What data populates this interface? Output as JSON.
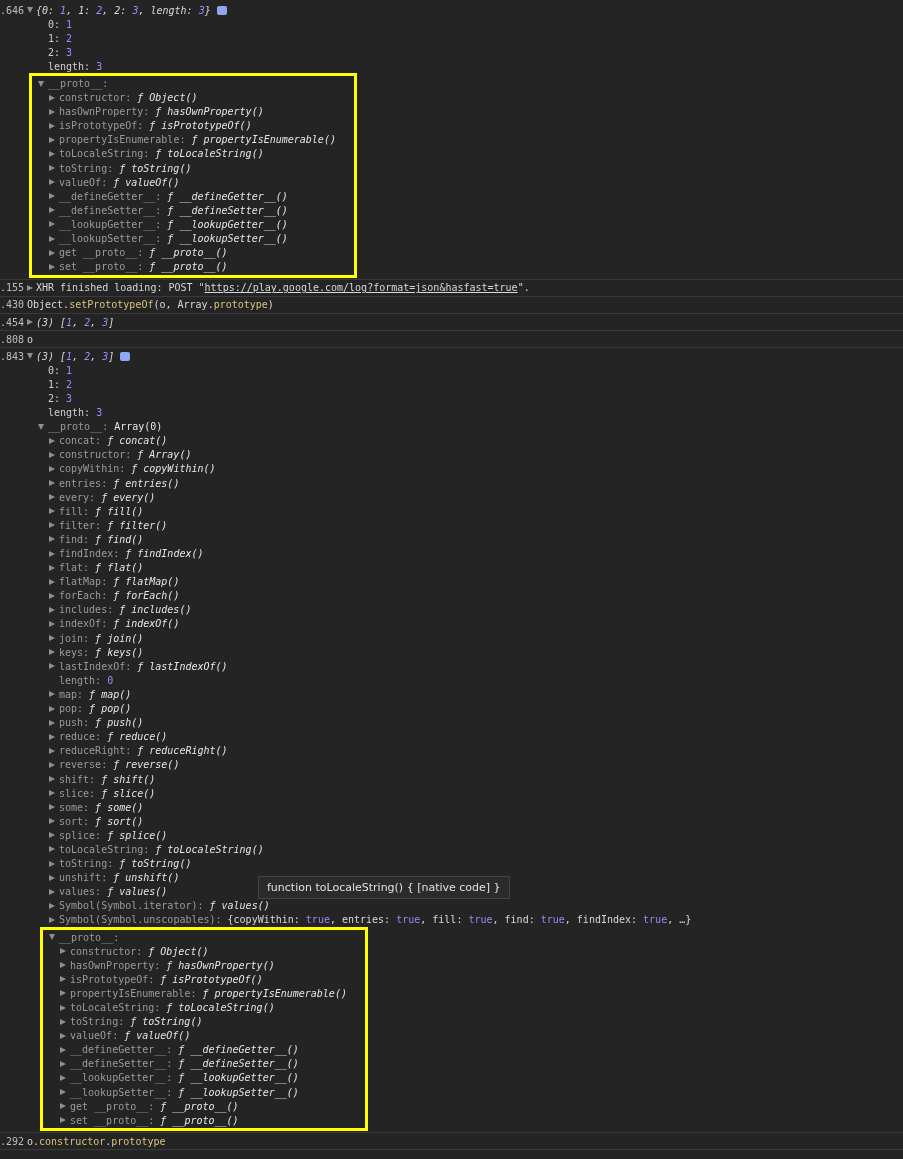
{
  "entries": [
    {
      "time": ".646",
      "kind": "value",
      "expanded": true,
      "info_badge": true,
      "tokens": [
        {
          "text": "{0: ",
          "kind": "punct"
        },
        {
          "text": "1",
          "kind": "number"
        },
        {
          "text": ", 1: ",
          "kind": "punct"
        },
        {
          "text": "2",
          "kind": "number"
        },
        {
          "text": ", 2: ",
          "kind": "punct"
        },
        {
          "text": "3",
          "kind": "number"
        },
        {
          "text": ", length: ",
          "kind": "punct"
        },
        {
          "text": "3",
          "kind": "number"
        },
        {
          "text": "}",
          "kind": "punct"
        }
      ],
      "children": [
        {
          "key": "0:",
          "value": "1",
          "kind": "number",
          "enumerable": true
        },
        {
          "key": "1:",
          "value": "2",
          "kind": "number",
          "enumerable": true
        },
        {
          "key": "2:",
          "value": "3",
          "kind": "number",
          "enumerable": true
        },
        {
          "key": "length:",
          "value": "3",
          "kind": "number",
          "enumerable": true
        },
        {
          "key": "__proto__:",
          "kind": "none",
          "enumerable": false,
          "expanded": true,
          "highlighted": true,
          "children": [
            {
              "key": "constructor:",
              "value": "ƒ Object()",
              "kind": "function",
              "enumerable": false,
              "expanded": false
            },
            {
              "key": "hasOwnProperty:",
              "value": "ƒ hasOwnProperty()",
              "kind": "function",
              "enumerable": false,
              "expanded": false
            },
            {
              "key": "isPrototypeOf:",
              "value": "ƒ isPrototypeOf()",
              "kind": "function",
              "enumerable": false,
              "expanded": false
            },
            {
              "key": "propertyIsEnumerable:",
              "value": "ƒ propertyIsEnumerable()",
              "kind": "function",
              "enumerable": false,
              "expanded": false
            },
            {
              "key": "toLocaleString:",
              "value": "ƒ toLocaleString()",
              "kind": "function",
              "enumerable": false,
              "expanded": false
            },
            {
              "key": "toString:",
              "value": "ƒ toString()",
              "kind": "function",
              "enumerable": false,
              "expanded": false
            },
            {
              "key": "valueOf:",
              "value": "ƒ valueOf()",
              "kind": "function",
              "enumerable": false,
              "expanded": false
            },
            {
              "key": "__defineGetter__:",
              "value": "ƒ __defineGetter__()",
              "kind": "function",
              "enumerable": false,
              "expanded": false
            },
            {
              "key": "__defineSetter__:",
              "value": "ƒ __defineSetter__()",
              "kind": "function",
              "enumerable": false,
              "expanded": false
            },
            {
              "key": "__lookupGetter__:",
              "value": "ƒ __lookupGetter__()",
              "kind": "function",
              "enumerable": false,
              "expanded": false
            },
            {
              "key": "__lookupSetter__:",
              "value": "ƒ __lookupSetter__()",
              "kind": "function",
              "enumerable": false,
              "expanded": false
            },
            {
              "key": "get __proto__:",
              "value": "ƒ __proto__()",
              "kind": "function",
              "enumerable": false,
              "expanded": false
            },
            {
              "key": "set __proto__:",
              "value": "ƒ __proto__()",
              "kind": "function",
              "enumerable": false,
              "expanded": false
            }
          ]
        }
      ]
    },
    {
      "time": ".155",
      "kind": "message",
      "expanded": false,
      "tokens": [
        {
          "text": "XHR finished loading: POST \"",
          "kind": "text"
        },
        {
          "text": "https://play.google.com/log?format=json&hasfast=true",
          "kind": "link"
        },
        {
          "text": "\".",
          "kind": "text"
        }
      ]
    },
    {
      "time": ".430",
      "kind": "command",
      "tokens": [
        {
          "text": "Object.",
          "kind": "text"
        },
        {
          "text": "setPrototypeOf",
          "kind": "member"
        },
        {
          "text": "(o, Array.",
          "kind": "text"
        },
        {
          "text": "prototype",
          "kind": "member"
        },
        {
          "text": ")",
          "kind": "text"
        }
      ]
    },
    {
      "time": ".454",
      "kind": "value",
      "expanded": false,
      "tokens": [
        {
          "text": "(3) [",
          "kind": "punct"
        },
        {
          "text": "1",
          "kind": "number"
        },
        {
          "text": ", ",
          "kind": "punct"
        },
        {
          "text": "2",
          "kind": "number"
        },
        {
          "text": ", ",
          "kind": "punct"
        },
        {
          "text": "3",
          "kind": "number"
        },
        {
          "text": "]",
          "kind": "punct"
        }
      ]
    },
    {
      "time": ".808",
      "kind": "command",
      "tokens": [
        {
          "text": "o",
          "kind": "text"
        }
      ]
    },
    {
      "time": ".843",
      "kind": "value",
      "expanded": true,
      "info_badge": true,
      "tokens": [
        {
          "text": "(3) [",
          "kind": "punct"
        },
        {
          "text": "1",
          "kind": "number"
        },
        {
          "text": ", ",
          "kind": "punct"
        },
        {
          "text": "2",
          "kind": "number"
        },
        {
          "text": ", ",
          "kind": "punct"
        },
        {
          "text": "3",
          "kind": "number"
        },
        {
          "text": "]",
          "kind": "punct"
        }
      ],
      "children": [
        {
          "key": "0:",
          "value": "1",
          "kind": "number",
          "enumerable": true
        },
        {
          "key": "1:",
          "value": "2",
          "kind": "number",
          "enumerable": true
        },
        {
          "key": "2:",
          "value": "3",
          "kind": "number",
          "enumerable": true
        },
        {
          "key": "length:",
          "value": "3",
          "kind": "number",
          "enumerable": true
        },
        {
          "key": "__proto__:",
          "value": "Array(0)",
          "kind": "plain",
          "enumerable": false,
          "expanded": true,
          "children": [
            {
              "key": "concat:",
              "value": "ƒ concat()",
              "kind": "function",
              "enumerable": false,
              "expanded": false
            },
            {
              "key": "constructor:",
              "value": "ƒ Array()",
              "kind": "function",
              "enumerable": false,
              "expanded": false
            },
            {
              "key": "copyWithin:",
              "value": "ƒ copyWithin()",
              "kind": "function",
              "enumerable": false,
              "expanded": false
            },
            {
              "key": "entries:",
              "value": "ƒ entries()",
              "kind": "function",
              "enumerable": false,
              "expanded": false
            },
            {
              "key": "every:",
              "value": "ƒ every()",
              "kind": "function",
              "enumerable": false,
              "expanded": false
            },
            {
              "key": "fill:",
              "value": "ƒ fill()",
              "kind": "function",
              "enumerable": false,
              "expanded": false
            },
            {
              "key": "filter:",
              "value": "ƒ filter()",
              "kind": "function",
              "enumerable": false,
              "expanded": false
            },
            {
              "key": "find:",
              "value": "ƒ find()",
              "kind": "function",
              "enumerable": false,
              "expanded": false
            },
            {
              "key": "findIndex:",
              "value": "ƒ findIndex()",
              "kind": "function",
              "enumerable": false,
              "expanded": false
            },
            {
              "key": "flat:",
              "value": "ƒ flat()",
              "kind": "function",
              "enumerable": false,
              "expanded": false
            },
            {
              "key": "flatMap:",
              "value": "ƒ flatMap()",
              "kind": "function",
              "enumerable": false,
              "expanded": false
            },
            {
              "key": "forEach:",
              "value": "ƒ forEach()",
              "kind": "function",
              "enumerable": false,
              "expanded": false
            },
            {
              "key": "includes:",
              "value": "ƒ includes()",
              "kind": "function",
              "enumerable": false,
              "expanded": false
            },
            {
              "key": "indexOf:",
              "value": "ƒ indexOf()",
              "kind": "function",
              "enumerable": false,
              "expanded": false
            },
            {
              "key": "join:",
              "value": "ƒ join()",
              "kind": "function",
              "enumerable": false,
              "expanded": false
            },
            {
              "key": "keys:",
              "value": "ƒ keys()",
              "kind": "function",
              "enumerable": false,
              "expanded": false
            },
            {
              "key": "lastIndexOf:",
              "value": "ƒ lastIndexOf()",
              "kind": "function",
              "enumerable": false,
              "expanded": false
            },
            {
              "key": "length:",
              "value": "0",
              "kind": "number",
              "enumerable": false
            },
            {
              "key": "map:",
              "value": "ƒ map()",
              "kind": "function",
              "enumerable": false,
              "expanded": false
            },
            {
              "key": "pop:",
              "value": "ƒ pop()",
              "kind": "function",
              "enumerable": false,
              "expanded": false
            },
            {
              "key": "push:",
              "value": "ƒ push()",
              "kind": "function",
              "enumerable": false,
              "expanded": false
            },
            {
              "key": "reduce:",
              "value": "ƒ reduce()",
              "kind": "function",
              "enumerable": false,
              "expanded": false
            },
            {
              "key": "reduceRight:",
              "value": "ƒ reduceRight()",
              "kind": "function",
              "enumerable": false,
              "expanded": false
            },
            {
              "key": "reverse:",
              "value": "ƒ reverse()",
              "kind": "function",
              "enumerable": false,
              "expanded": false
            },
            {
              "key": "shift:",
              "value": "ƒ shift()",
              "kind": "function",
              "enumerable": false,
              "expanded": false
            },
            {
              "key": "slice:",
              "value": "ƒ slice()",
              "kind": "function",
              "enumerable": false,
              "expanded": false
            },
            {
              "key": "some:",
              "value": "ƒ some()",
              "kind": "function",
              "enumerable": false,
              "expanded": false
            },
            {
              "key": "sort:",
              "value": "ƒ sort()",
              "kind": "function",
              "enumerable": false,
              "expanded": false
            },
            {
              "key": "splice:",
              "value": "ƒ splice()",
              "kind": "function",
              "enumerable": false,
              "expanded": false
            },
            {
              "key": "toLocaleString:",
              "value": "ƒ toLocaleString()",
              "kind": "function",
              "enumerable": false,
              "expanded": false
            },
            {
              "key": "toString:",
              "value": "ƒ toString()",
              "kind": "function",
              "enumerable": false,
              "expanded": false
            },
            {
              "key": "unshift:",
              "value": "ƒ unshift()",
              "kind": "function",
              "enumerable": false,
              "expanded": false
            },
            {
              "key": "values:",
              "value": "ƒ values()",
              "kind": "function",
              "enumerable": false,
              "expanded": false
            },
            {
              "key": "Symbol(Symbol.iterator):",
              "value": "ƒ values()",
              "kind": "function",
              "enumerable": false,
              "expanded": false
            },
            {
              "key": "Symbol(Symbol.unscopables):",
              "kind": "preview",
              "value_tokens": [
                {
                  "text": "{copyWithin: ",
                  "kind": "text"
                },
                {
                  "text": "true",
                  "kind": "bool"
                },
                {
                  "text": ", entries: ",
                  "kind": "text"
                },
                {
                  "text": "true",
                  "kind": "bool"
                },
                {
                  "text": ", fill: ",
                  "kind": "text"
                },
                {
                  "text": "true",
                  "kind": "bool"
                },
                {
                  "text": ", find: ",
                  "kind": "text"
                },
                {
                  "text": "true",
                  "kind": "bool"
                },
                {
                  "text": ", findIndex: ",
                  "kind": "text"
                },
                {
                  "text": "true",
                  "kind": "bool"
                },
                {
                  "text": ", …}",
                  "kind": "text"
                }
              ],
              "enumerable": false,
              "expanded": false
            },
            {
              "key": "__proto__:",
              "kind": "none",
              "enumerable": false,
              "expanded": true,
              "highlighted": true,
              "children": [
                {
                  "key": "constructor:",
                  "value": "ƒ Object()",
                  "kind": "function",
                  "enumerable": false,
                  "expanded": false
                },
                {
                  "key": "hasOwnProperty:",
                  "value": "ƒ hasOwnProperty()",
                  "kind": "function",
                  "enumerable": false,
                  "expanded": false
                },
                {
                  "key": "isPrototypeOf:",
                  "value": "ƒ isPrototypeOf()",
                  "kind": "function",
                  "enumerable": false,
                  "expanded": false
                },
                {
                  "key": "propertyIsEnumerable:",
                  "value": "ƒ propertyIsEnumerable()",
                  "kind": "function",
                  "enumerable": false,
                  "expanded": false
                },
                {
                  "key": "toLocaleString:",
                  "value": "ƒ toLocaleString()",
                  "kind": "function",
                  "enumerable": false,
                  "expanded": false
                },
                {
                  "key": "toString:",
                  "value": "ƒ toString()",
                  "kind": "function",
                  "enumerable": false,
                  "expanded": false
                },
                {
                  "key": "valueOf:",
                  "value": "ƒ valueOf()",
                  "kind": "function",
                  "enumerable": false,
                  "expanded": false
                },
                {
                  "key": "__defineGetter__:",
                  "value": "ƒ __defineGetter__()",
                  "kind": "function",
                  "enumerable": false,
                  "expanded": false
                },
                {
                  "key": "__defineSetter__:",
                  "value": "ƒ __defineSetter__()",
                  "kind": "function",
                  "enumerable": false,
                  "expanded": false
                },
                {
                  "key": "__lookupGetter__:",
                  "value": "ƒ __lookupGetter__()",
                  "kind": "function",
                  "enumerable": false,
                  "expanded": false
                },
                {
                  "key": "__lookupSetter__:",
                  "value": "ƒ __lookupSetter__()",
                  "kind": "function",
                  "enumerable": false,
                  "expanded": false
                },
                {
                  "key": "get __proto__:",
                  "value": "ƒ __proto__()",
                  "kind": "function",
                  "enumerable": false,
                  "expanded": false
                },
                {
                  "key": "set __proto__:",
                  "value": "ƒ __proto__()",
                  "kind": "function",
                  "enumerable": false,
                  "expanded": false
                }
              ]
            }
          ]
        }
      ]
    },
    {
      "time": ".292",
      "kind": "command",
      "tokens": [
        {
          "text": "o.",
          "kind": "text"
        },
        {
          "text": "constructor",
          "kind": "member"
        },
        {
          "text": ".",
          "kind": "text"
        },
        {
          "text": "prototype",
          "kind": "member"
        }
      ]
    }
  ],
  "tooltip": {
    "text": "function toLocaleString() { [native code] }"
  }
}
